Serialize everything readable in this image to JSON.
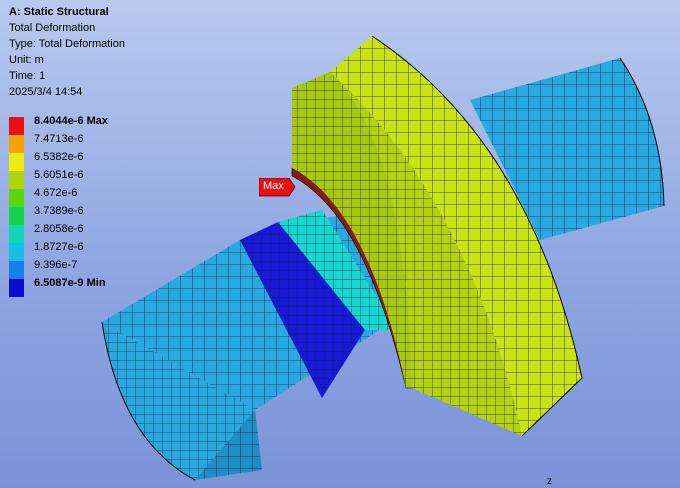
{
  "header": {
    "title": "A: Static Structural",
    "result": "Total Deformation",
    "type": "Type: Total Deformation",
    "unit": "Unit: m",
    "time": "Time: 1",
    "date": "2025/3/4 14:54"
  },
  "legend": {
    "items": [
      {
        "label": "8.4044e-6 Max",
        "color": "#e81010",
        "bold": true
      },
      {
        "label": "7.4713e-6",
        "color": "#f2a400",
        "bold": false
      },
      {
        "label": "6.5382e-6",
        "color": "#ecec12",
        "bold": false
      },
      {
        "label": "5.6051e-6",
        "color": "#b0d40e",
        "bold": false
      },
      {
        "label": "4.672e-6",
        "color": "#58d60e",
        "bold": false
      },
      {
        "label": "3.7389e-6",
        "color": "#12d44e",
        "bold": false
      },
      {
        "label": "2.8058e-6",
        "color": "#12d6b2",
        "bold": false
      },
      {
        "label": "1.8727e-6",
        "color": "#16bfe8",
        "bold": false
      },
      {
        "label": "9.396e-7",
        "color": "#1680ea",
        "bold": false
      },
      {
        "label": "6.5087e-9 Min",
        "color": "#0c0ccc",
        "bold": true
      }
    ]
  },
  "probe": {
    "max_label": "Max"
  },
  "triad": {
    "axis_label": "z"
  },
  "colors": {
    "shaft": "#2aa8e0",
    "ring": "#c8e414",
    "band_min": "#1818d8",
    "band_mid": "#16d8d0",
    "contact": "#8a1a10",
    "mesh_line": "#1a2a4a"
  }
}
